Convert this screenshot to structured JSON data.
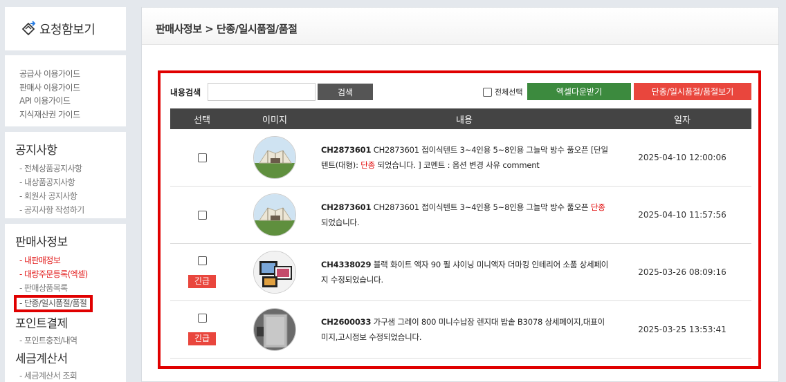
{
  "sidebar": {
    "logo_text": "요청함보기",
    "guides": [
      "공급사 이용가이드",
      "판매사 이용가이드",
      "API 이용가이드",
      "지식재산권 가이드"
    ],
    "notice": {
      "title": "공지사항",
      "items": [
        "- 전체상품공지사항",
        "- 내상품공지사항",
        "- 회원사 공지사항",
        "- 공지사항 작성하기"
      ]
    },
    "seller": {
      "title": "판매사정보",
      "items": [
        "- 내판매정보",
        "- 대량주문등록(엑셀)",
        "- 판매상품목록",
        "- 단종/일시품절/품절"
      ]
    },
    "point": {
      "title": "포인트결제",
      "items": [
        "- 포인트충전/내역"
      ]
    },
    "tax": {
      "title": "세금계산서",
      "items": [
        "- 세금계산서 조회"
      ]
    }
  },
  "main": {
    "breadcrumb": "판매사정보 > 단종/일시품절/품절",
    "search_label": "내용검색",
    "search_value": "",
    "search_button": "검색",
    "select_all": "전체선택",
    "excel_button": "엑셀다운받기",
    "view_button": "단종/일시품절/품절보기",
    "columns": [
      "선택",
      "이미지",
      "내용",
      "일자"
    ],
    "rows": [
      {
        "code": "CH2873601",
        "text_before": " CH2873601 접이식텐트 3~4인용 5~8인용 그늘막 방수 풀오픈 [단일텐트(대형): ",
        "status": "단종",
        "text_after": " 되었습니다. ] 코멘트 : 옵션 변경 사유 comment",
        "date": "2025-04-10 12:00:06",
        "urgent": "",
        "image": "tent-image"
      },
      {
        "code": "CH2873601",
        "text_before": " CH2873601 접이식텐트 3~4인용 5~8인용 그늘막 방수 풀오픈 ",
        "status": "단종",
        "text_after": "되었습니다.",
        "date": "2025-04-10 11:57:56",
        "urgent": "",
        "image": "tent-image"
      },
      {
        "code": "CH4338029",
        "text_before": " 블랙 화이트 액자 90 필 샤이닝 미니액자 더마킹 인테리어 소품 상세페이지 수정되었습니다.",
        "status": "",
        "text_after": "",
        "date": "2025-03-26 08:09:16",
        "urgent": "긴급",
        "image": "frame-image"
      },
      {
        "code": "CH2600033",
        "text_before": " 가구샘 그레이 800 미니수납장 렌지대 밥솥 B3078 상세페이지,대표이미지,고시정보 수정되었습니다.",
        "status": "",
        "text_after": "",
        "date": "2025-03-25 13:53:41",
        "urgent": "긴급",
        "image": "cabinet-image"
      }
    ]
  },
  "colors": {
    "highlight_frame": "#e00000",
    "excel_green": "#3c8a3e",
    "view_red": "#e9463d",
    "header_dark": "#444444"
  }
}
